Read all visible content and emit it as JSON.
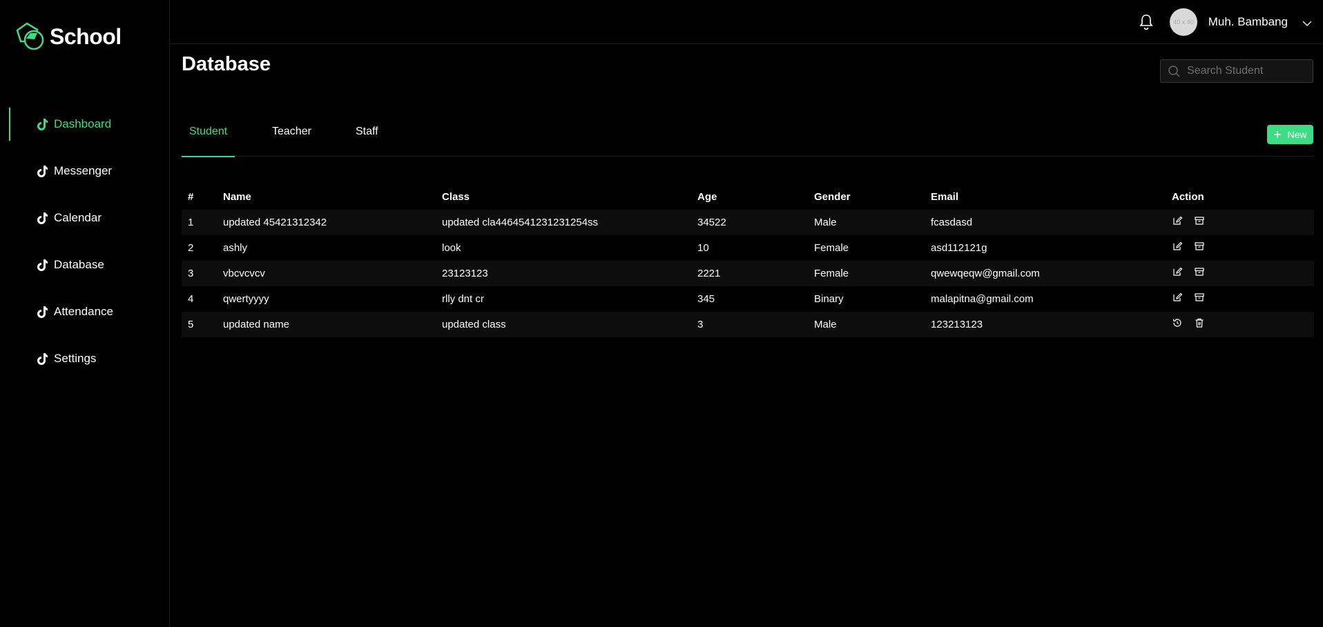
{
  "app": {
    "logo_text": "School"
  },
  "sidebar": {
    "items": [
      {
        "label": "Dashboard",
        "active": true,
        "icon": "tiktok-icon"
      },
      {
        "label": "Messenger",
        "active": false,
        "icon": "tiktok-icon"
      },
      {
        "label": "Calendar",
        "active": false,
        "icon": "tiktok-icon"
      },
      {
        "label": "Database",
        "active": false,
        "icon": "tiktok-icon"
      },
      {
        "label": "Attendance",
        "active": false,
        "icon": "tiktok-icon"
      },
      {
        "label": "Settings",
        "active": false,
        "icon": "tiktok-icon"
      }
    ]
  },
  "header": {
    "avatar_text": "40 x 40",
    "username": "Muh. Bambang"
  },
  "main": {
    "title": "Database",
    "search": {
      "placeholder": "Search Student"
    },
    "tabs": [
      {
        "label": "Student",
        "active": true
      },
      {
        "label": "Teacher",
        "active": false
      },
      {
        "label": "Staff",
        "active": false
      }
    ],
    "new_button": "New"
  },
  "table": {
    "columns": [
      "#",
      "Name",
      "Class",
      "Age",
      "Gender",
      "Email",
      "Action"
    ],
    "rows": [
      {
        "num": "1",
        "name": "updated 45421312342",
        "class": "updated cla4464541231231254ss",
        "age": "34522",
        "gender": "Male",
        "email": "fcasdasd",
        "actions": [
          "edit-icon",
          "archive-icon"
        ]
      },
      {
        "num": "2",
        "name": "ashly",
        "class": "look",
        "age": "10",
        "gender": "Female",
        "email": "asd112121g",
        "actions": [
          "edit-icon",
          "archive-icon"
        ]
      },
      {
        "num": "3",
        "name": "vbcvcvcv",
        "class": "23123123",
        "age": "2221",
        "gender": "Female",
        "email": "qwewqeqw@gmail.com",
        "actions": [
          "edit-icon",
          "archive-icon"
        ]
      },
      {
        "num": "4",
        "name": "qwertyyyy",
        "class": "rlly dnt cr",
        "age": "345",
        "gender": "Binary",
        "email": "malapitna@gmail.com",
        "actions": [
          "edit-icon",
          "archive-icon"
        ]
      },
      {
        "num": "5",
        "name": "updated name",
        "class": "updated class",
        "age": "3",
        "gender": "Male",
        "email": "123213123",
        "actions": [
          "restore-icon",
          "delete-icon"
        ]
      }
    ]
  },
  "colors": {
    "accent": "#3ddc84",
    "background": "#000000",
    "row_alt": "#0d0d0d"
  }
}
